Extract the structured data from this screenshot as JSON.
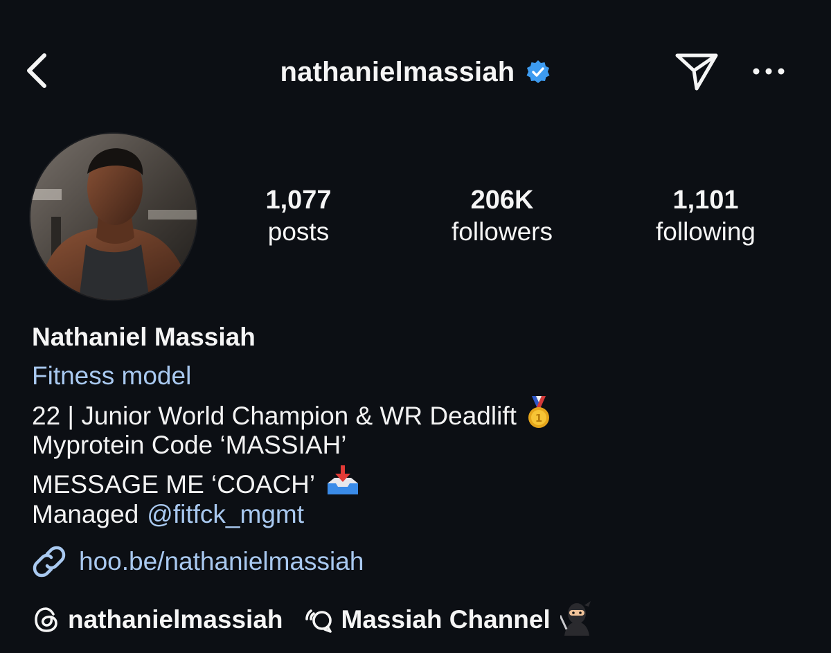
{
  "header": {
    "username": "nathanielmassiah",
    "verified": true,
    "icons": {
      "back": "chevron-left-icon",
      "send": "paper-plane-icon",
      "more": "more-horizontal-icon",
      "verified": "verified-badge-icon"
    }
  },
  "profile": {
    "avatar_alt": "profile-photo",
    "stats": [
      {
        "value": "1,077",
        "label": "posts"
      },
      {
        "value": "206K",
        "label": "followers"
      },
      {
        "value": "1,101",
        "label": "following"
      }
    ]
  },
  "bio": {
    "full_name": "Nathaniel Massiah",
    "category": "Fitness model",
    "line1": "22 | Junior World Champion & WR Deadlift",
    "line2": "Myprotein Code ‘MASSIAH’",
    "line3": "MESSAGE ME ‘COACH’",
    "line4_prefix": "Managed",
    "line4_mention": "@fitfck_mgmt",
    "emojis": {
      "line1": "gold-medal-icon",
      "line3": "inbox-tray-icon"
    }
  },
  "link": {
    "text": "hoo.be/nathanielmassiah",
    "icon": "link-icon"
  },
  "chips": [
    {
      "icon": "threads-icon",
      "label": "nathanielmassiah"
    },
    {
      "icon": "broadcast-channel-icon",
      "label": "Massiah Channel"
    }
  ],
  "chip_emoji": "ninja-icon",
  "colors": {
    "background": "#0c0f14",
    "text": "#f5f5f5",
    "link": "#a9c9f0",
    "verified": "#3d9bf0"
  }
}
